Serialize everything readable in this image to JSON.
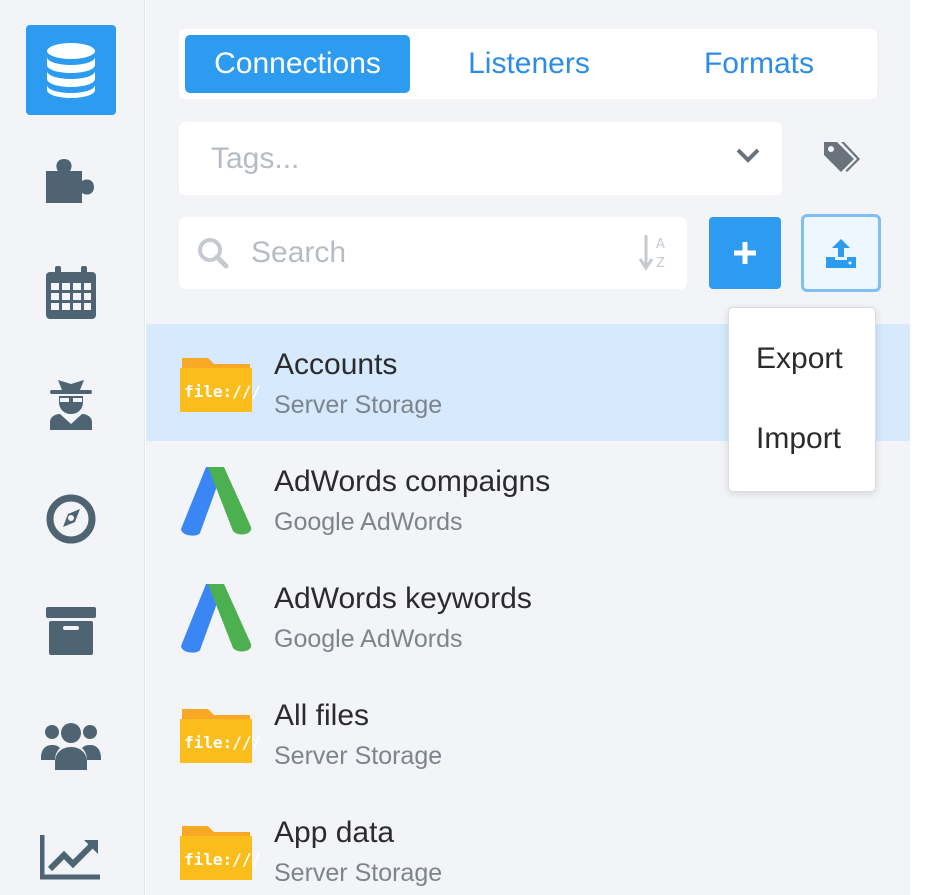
{
  "sidebar": {
    "items": [
      {
        "name": "databases",
        "icon": "database-icon",
        "active": true
      },
      {
        "name": "plugins",
        "icon": "puzzle-icon",
        "active": false
      },
      {
        "name": "schedule",
        "icon": "calendar-icon",
        "active": false
      },
      {
        "name": "agents",
        "icon": "spy-icon",
        "active": false
      },
      {
        "name": "explore",
        "icon": "compass-icon",
        "active": false
      },
      {
        "name": "archive",
        "icon": "archive-icon",
        "active": false
      },
      {
        "name": "users",
        "icon": "users-icon",
        "active": false
      },
      {
        "name": "analytics",
        "icon": "chart-line-icon",
        "active": false
      }
    ]
  },
  "tabs": [
    {
      "label": "Connections",
      "active": true
    },
    {
      "label": "Listeners",
      "active": false
    },
    {
      "label": "Formats",
      "active": false
    }
  ],
  "tags": {
    "placeholder": "Tags...",
    "icon": "tags-icon"
  },
  "search": {
    "placeholder": "Search",
    "value": "",
    "sort_icon": "sort-alpha-icon"
  },
  "toolbar": {
    "add_icon": "plus-icon",
    "upload_icon": "upload-icon"
  },
  "menu": {
    "export_label": "Export",
    "import_label": "Import"
  },
  "connections": [
    {
      "name": "Accounts",
      "type": "Server Storage",
      "icon": "file-folder-icon",
      "icon_text": "file:///",
      "selected": true
    },
    {
      "name": "AdWords compaigns",
      "type": "Google AdWords",
      "icon": "adwords-icon",
      "selected": false
    },
    {
      "name": "AdWords keywords",
      "type": "Google AdWords",
      "icon": "adwords-icon",
      "selected": false
    },
    {
      "name": "All files",
      "type": "Server Storage",
      "icon": "file-folder-icon",
      "icon_text": "file:///",
      "selected": false
    },
    {
      "name": "App data",
      "type": "Server Storage",
      "icon": "file-folder-icon",
      "icon_text": "file:///",
      "selected": false
    }
  ],
  "colors": {
    "accent": "#2d9bf0",
    "rail_icon": "#4f6472",
    "selected_row": "#d6e9fd",
    "folder": "#fbbd1b",
    "adwords_blue": "#3b86f5",
    "adwords_green": "#4caf50"
  }
}
